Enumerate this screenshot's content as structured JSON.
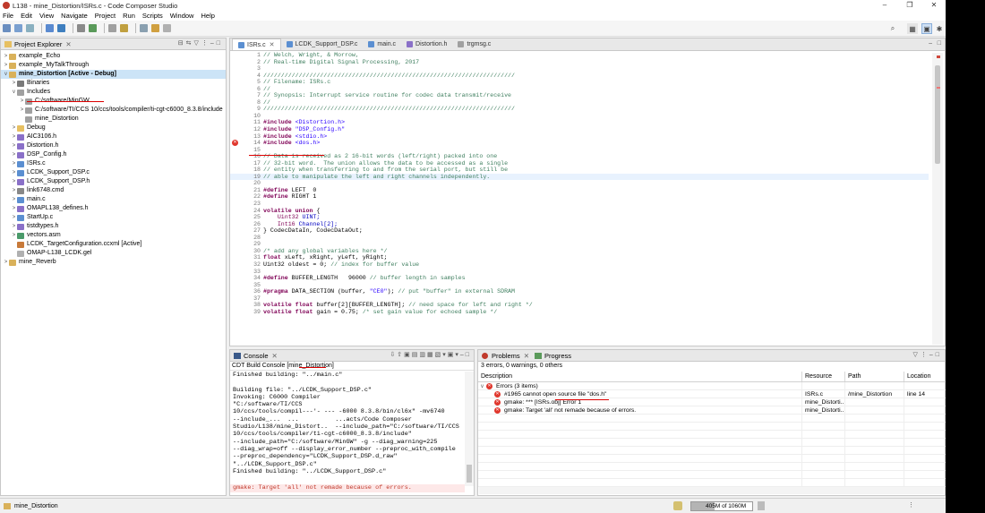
{
  "window": {
    "title": "L138 - mine_Distortion/ISRs.c - Code Composer Studio",
    "controls": [
      "–",
      "❐",
      "✕"
    ]
  },
  "menu": [
    "File",
    "Edit",
    "View",
    "Navigate",
    "Project",
    "Run",
    "Scripts",
    "Window",
    "Help"
  ],
  "project_explorer": {
    "tab_label": "Project Explorer",
    "items": [
      {
        "label": "example_Echo",
        "indent": 0,
        "arrow": ">",
        "icon": "proj"
      },
      {
        "label": "example_MyTalkThrough",
        "indent": 0,
        "arrow": ">",
        "icon": "proj"
      },
      {
        "label": "mine_Distortion  [Active - Debug]",
        "indent": 0,
        "arrow": "v",
        "icon": "proj",
        "bold": true
      },
      {
        "label": "Binaries",
        "indent": 1,
        "arrow": ">",
        "icon": "gear"
      },
      {
        "label": "Includes",
        "indent": 1,
        "arrow": "v",
        "icon": "inc"
      },
      {
        "label": "C:/software/MinGW",
        "indent": 2,
        "arrow": ">",
        "icon": "inc"
      },
      {
        "label": "C:/software/TI/CCS 10/ccs/tools/compiler/ti-cgt-c6000_8.3.8/include",
        "indent": 2,
        "arrow": ">",
        "icon": "inc"
      },
      {
        "label": "mine_Distortion",
        "indent": 2,
        "arrow": "",
        "icon": "inc"
      },
      {
        "label": "Debug",
        "indent": 1,
        "arrow": ">",
        "icon": "folder"
      },
      {
        "label": "AIC3106.h",
        "indent": 1,
        "arrow": ">",
        "icon": "h"
      },
      {
        "label": "Distortion.h",
        "indent": 1,
        "arrow": ">",
        "icon": "h"
      },
      {
        "label": "DSP_Config.h",
        "indent": 1,
        "arrow": ">",
        "icon": "h"
      },
      {
        "label": "ISRs.c",
        "indent": 1,
        "arrow": ">",
        "icon": "c"
      },
      {
        "label": "LCDK_Support_DSP.c",
        "indent": 1,
        "arrow": ">",
        "icon": "c"
      },
      {
        "label": "LCDK_Support_DSP.h",
        "indent": 1,
        "arrow": ">",
        "icon": "h"
      },
      {
        "label": "link6748.cmd",
        "indent": 1,
        "arrow": ">",
        "icon": "cmd"
      },
      {
        "label": "main.c",
        "indent": 1,
        "arrow": ">",
        "icon": "c"
      },
      {
        "label": "OMAPL138_defines.h",
        "indent": 1,
        "arrow": ">",
        "icon": "h"
      },
      {
        "label": "StartUp.c",
        "indent": 1,
        "arrow": ">",
        "icon": "c"
      },
      {
        "label": "tistdtypes.h",
        "indent": 1,
        "arrow": ">",
        "icon": "h"
      },
      {
        "label": "vectors.asm",
        "indent": 1,
        "arrow": ">",
        "icon": "asm"
      },
      {
        "label": "LCDK_TargetConfiguration.ccxml [Active]",
        "indent": 1,
        "arrow": "",
        "icon": "xml"
      },
      {
        "label": "OMAP-L138_LCDK.gel",
        "indent": 1,
        "arrow": "",
        "icon": "gel"
      },
      {
        "label": "mine_Reverb",
        "indent": 0,
        "arrow": ">",
        "icon": "proj"
      }
    ]
  },
  "editor": {
    "tabs": [
      {
        "label": "ISRs.c",
        "active": true
      },
      {
        "label": "LCDK_Support_DSP.c",
        "active": false
      },
      {
        "label": "main.c",
        "active": false
      },
      {
        "label": "Distortion.h",
        "active": false
      },
      {
        "label": "trgmsg.c",
        "active": false
      }
    ],
    "lines": [
      {
        "n": "1",
        "t": "// Welch, Wright, & Morrow,",
        "k": "cm"
      },
      {
        "n": "2",
        "t": "// Real-time Digital Signal Processing, 2017",
        "k": "cm"
      },
      {
        "n": "3",
        "t": "",
        "k": ""
      },
      {
        "n": "4",
        "t": "///////////////////////////////////////////////////////////////////////",
        "k": "cm"
      },
      {
        "n": "5",
        "t": "// Filename: ISRs.c",
        "k": "cm"
      },
      {
        "n": "6",
        "t": "//",
        "k": "cm"
      },
      {
        "n": "7",
        "t": "// Synopsis: Interrupt service routine for codec data transmit/receive",
        "k": "cm"
      },
      {
        "n": "8",
        "t": "//",
        "k": "cm"
      },
      {
        "n": "9",
        "t": "///////////////////////////////////////////////////////////////////////",
        "k": "cm"
      },
      {
        "n": "10",
        "t": "",
        "k": ""
      },
      {
        "n": "11",
        "t": "#include <Distortion.h>",
        "k": "inc"
      },
      {
        "n": "12",
        "t": "#include \"DSP_Config.h\"",
        "k": "inc"
      },
      {
        "n": "13",
        "t": "#include <stdio.h>",
        "k": "inc"
      },
      {
        "n": "14",
        "t": "#include <dos.h>",
        "k": "inc",
        "err": true
      },
      {
        "n": "15",
        "t": "",
        "k": ""
      },
      {
        "n": "16",
        "t": "// Data is received as 2 16-bit words (left/right) packed into one",
        "k": "cm"
      },
      {
        "n": "17",
        "t": "// 32-bit word.  The union allows the data to be accessed as a single",
        "k": "cm"
      },
      {
        "n": "18",
        "t": "// entity when transferring to and from the serial port, but still be",
        "k": "cm"
      },
      {
        "n": "19",
        "t": "// able to manipulate the left and right channels independently.",
        "k": "cm",
        "hl": true
      },
      {
        "n": "20",
        "t": "",
        "k": ""
      },
      {
        "n": "21",
        "t": "#define LEFT  0",
        "k": "def"
      },
      {
        "n": "22",
        "t": "#define RIGHT 1",
        "k": "def"
      },
      {
        "n": "23",
        "t": "",
        "k": ""
      },
      {
        "n": "24",
        "t": "volatile union {",
        "k": "vol"
      },
      {
        "n": "25",
        "t": "    Uint32 UINT;",
        "k": "mem"
      },
      {
        "n": "26",
        "t": "    Int16 Channel[2];",
        "k": "mem"
      },
      {
        "n": "27",
        "t": "} CodecDataIn, CodecDataOut;",
        "k": ""
      },
      {
        "n": "28",
        "t": "",
        "k": ""
      },
      {
        "n": "29",
        "t": "",
        "k": ""
      },
      {
        "n": "30",
        "t": "/* add any global variables here */",
        "k": "cm"
      },
      {
        "n": "31",
        "t": "float xLeft, xRight, yLeft, yRight;",
        "k": "flt"
      },
      {
        "n": "32",
        "t": "Uint32 oldest = 0; // index for buffer value",
        "k": "u32"
      },
      {
        "n": "33",
        "t": "",
        "k": ""
      },
      {
        "n": "34",
        "t": "#define BUFFER_LENGTH   96000 // buffer length in samples",
        "k": "def2"
      },
      {
        "n": "35",
        "t": "",
        "k": ""
      },
      {
        "n": "36",
        "t": "#pragma DATA_SECTION (buffer, \"CE0\"); // put \"buffer\" in external SDRAM",
        "k": "prg"
      },
      {
        "n": "37",
        "t": "",
        "k": ""
      },
      {
        "n": "38",
        "t": "volatile float buffer[2][BUFFER_LENGTH]; // need space for left and right */",
        "k": "vf"
      },
      {
        "n": "39",
        "t": "volatile float gain = 0.75; /* set gain value for echoed sample */",
        "k": "vf"
      }
    ]
  },
  "console": {
    "tab_label": "Console",
    "subtitle": "CDT Build Console [mine_Distortion]",
    "lines": [
      "Finished building: \"../main.c\"",
      " ",
      "Building file: \"../LCDK_Support_DSP.c\"",
      "Invoking: C6000 Compiler",
      "\"C:/software/TI/CCS",
      "10/ccs/tools/compil---'- --- -6000 8.3.8/bin/cl6x\" -mv6740",
      "--include_...  ...          ...acts/Code Composer",
      "Studio/L138/mine_Distort..  --include_path=\"C:/software/TI/CCS",
      "10/ccs/tools/compiler/ti-cgt-c6000_8.3.8/include\"",
      "--include_path=\"C:/software/MinGW\" -g --diag_warning=225",
      "--diag_wrap=off --display_error_number --preproc_with_compile",
      "--preproc_dependency=\"LCDK_Support_DSP.d_raw\"",
      "\"../LCDK_Support_DSP.c\"",
      "Finished building: \"../LCDK_Support_DSP.c\""
    ],
    "error_line": "gmake: Target 'all' not remade because of errors."
  },
  "problems": {
    "tab_label": "Problems",
    "tab2_label": "Progress",
    "summary": "3 errors, 0 warnings, 0 others",
    "columns": [
      "Description",
      "Resource",
      "Path",
      "Location"
    ],
    "group": "Errors (3 items)",
    "rows": [
      {
        "desc": "#1965 cannot open source file \"dos.h\"",
        "res": "ISRs.c",
        "path": "/mine_Distortion",
        "loc": "line 14"
      },
      {
        "desc": "gmake: *** [ISRs.obj] Error 1",
        "res": "mine_Distorti...",
        "path": "",
        "loc": ""
      },
      {
        "desc": "gmake: Target 'all' not remade because of errors.",
        "res": "mine_Distorti...",
        "path": "",
        "loc": ""
      }
    ]
  },
  "status": {
    "project": "mine_Distortion",
    "heap": "405M of 1060M",
    "heap_fraction": 0.38
  }
}
